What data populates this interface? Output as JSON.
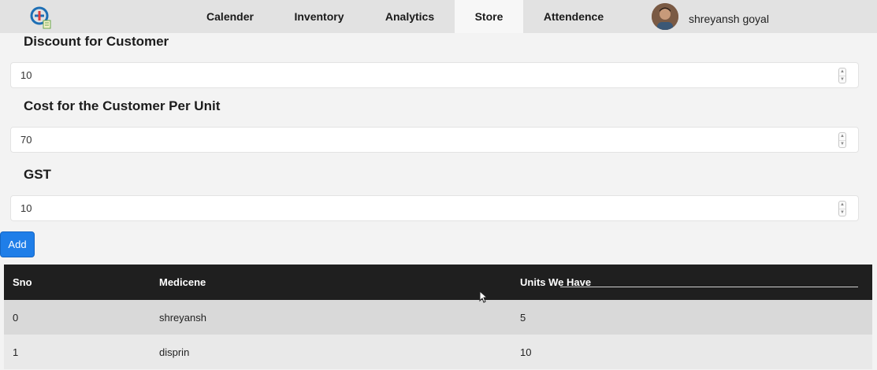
{
  "nav": {
    "items": [
      {
        "label": "Calender",
        "active": false
      },
      {
        "label": "Inventory",
        "active": false
      },
      {
        "label": "Analytics",
        "active": false
      },
      {
        "label": "Store",
        "active": true
      },
      {
        "label": "Attendence",
        "active": false
      }
    ],
    "user_name": "shreyansh goyal"
  },
  "form": {
    "fields": [
      {
        "label": "Discount for Customer",
        "value": "10"
      },
      {
        "label": "Cost for the Customer Per Unit",
        "value": "70"
      },
      {
        "label": "GST",
        "value": "10"
      }
    ],
    "add_label": "Add"
  },
  "table": {
    "headers": [
      "Sno",
      "Medicene",
      "Units We Have"
    ],
    "rows": [
      [
        "0",
        "shreyansh",
        "5"
      ],
      [
        "1",
        "disprin",
        "10"
      ]
    ]
  },
  "colors": {
    "navbar": "#e2e2e2",
    "accent": "#1f7ee8",
    "table_header": "#1f1f1f"
  }
}
